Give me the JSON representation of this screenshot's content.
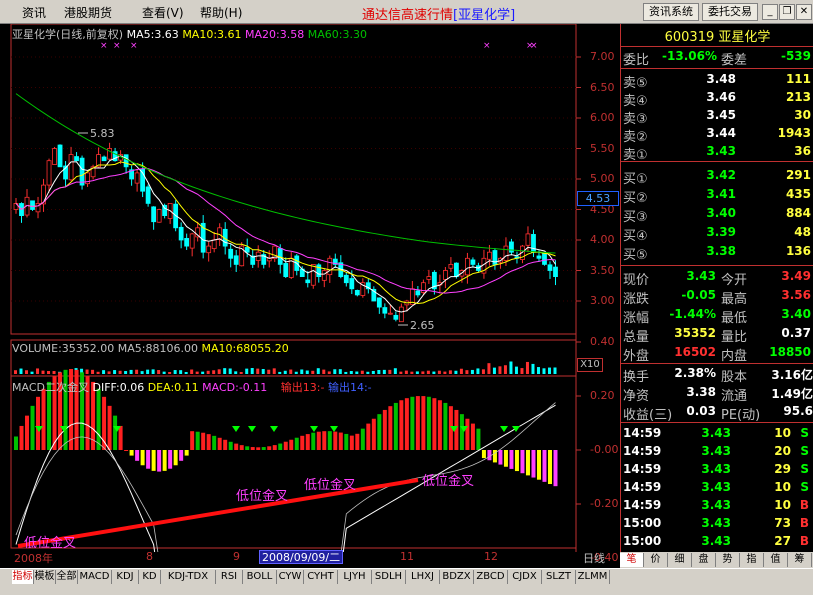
{
  "menu": [
    "资讯",
    "港股期货",
    "查看(V)",
    "帮助(H)"
  ],
  "app": {
    "title": "通达信高速行情",
    "stock_bracket": "[亚星化学]"
  },
  "topbuttons": [
    "资讯系统",
    "委托交易"
  ],
  "window_controls": [
    "minimize-icon",
    "restore-icon",
    "close-icon"
  ],
  "chart": {
    "header": {
      "name": "亚星化学(日线,前复权)",
      "ma5": "MA5:3.63",
      "ma10": "MA10:3.61",
      "ma20": "MA20:3.58",
      "ma60": "MA60:3.30"
    },
    "price_labels": [
      "7.00",
      "6.50",
      "6.00",
      "5.50",
      "5.00",
      "4.50",
      "4.00",
      "3.50",
      "3.00"
    ],
    "current_price": "4.53",
    "high_annotation": "5.83",
    "low_annotation": "2.65",
    "volume_header": {
      "vol": "VOLUME:35352.00",
      "ma5": "MA5:88106.00",
      "ma10": "MA10:68055.20"
    },
    "volume_scale": "X10",
    "macd_header": {
      "name": "MACD二次金叉",
      "diff": "DIFF:0.06",
      "dea": "DEA:0.11",
      "macd": "MACD:-0.11",
      "out13": "输出13:-",
      "out14": "输出14:-"
    },
    "macd_labels": [
      "0.40",
      "0.20",
      "-0.00",
      "-0.20",
      "-0.40"
    ],
    "annotations": [
      "低位金叉",
      "低位金叉",
      "低位金叉",
      "低位金叉"
    ],
    "dates": [
      "2008年",
      "8",
      "9",
      "11",
      "12"
    ],
    "cursor_date": "2008/09/09/二",
    "period": "日线",
    "colors": {
      "up": "#ff3030",
      "down": "#00ffff",
      "ma5": "#ffffff",
      "ma10": "#ffff00",
      "ma20": "#ff40ff",
      "ma60": "#00c000"
    }
  },
  "chart_data": {
    "type": "candlestick",
    "title": "亚星化学(日线,前复权)",
    "ylim": [
      2.5,
      7.25
    ],
    "high": 5.83,
    "low": 2.65,
    "close_series": [
      4.6,
      4.4,
      4.7,
      4.5,
      4.6,
      4.9,
      5.3,
      5.5,
      5.2,
      5.0,
      5.4,
      5.3,
      4.9,
      5.1,
      5.2,
      5.4,
      5.3,
      5.5,
      5.3,
      5.4,
      5.2,
      5.0,
      5.1,
      4.8,
      4.6,
      4.3,
      4.5,
      4.4,
      4.6,
      4.2,
      4.0,
      3.9,
      4.1,
      4.2,
      3.8,
      3.9,
      4.0,
      4.2,
      3.9,
      3.7,
      3.6,
      3.9,
      3.8,
      3.6,
      3.8,
      3.6,
      3.7,
      3.9,
      3.6,
      3.4,
      3.7,
      3.5,
      3.4,
      3.3,
      3.6,
      3.4,
      3.5,
      3.7,
      3.6,
      3.4,
      3.3,
      3.2,
      3.1,
      3.3,
      3.2,
      3.0,
      2.9,
      2.8,
      2.8,
      2.7,
      2.9,
      3.0,
      3.2,
      3.1,
      3.3,
      3.4,
      3.2,
      3.3,
      3.5,
      3.6,
      3.4,
      3.5,
      3.7,
      3.6,
      3.5,
      3.7,
      3.8,
      3.6,
      3.7,
      3.9,
      3.8,
      3.7,
      3.9,
      4.1,
      3.8,
      3.7,
      3.6,
      3.5,
      3.4
    ]
  },
  "panel": {
    "title": "600319 亚星化学",
    "weibi": {
      "label": "委比",
      "value": "-13.06%",
      "label2": "委差",
      "value2": "-539"
    },
    "sell": [
      {
        "label": "卖⑤",
        "price": "3.48",
        "vol": "111"
      },
      {
        "label": "卖④",
        "price": "3.46",
        "vol": "213"
      },
      {
        "label": "卖③",
        "price": "3.45",
        "vol": "30"
      },
      {
        "label": "卖②",
        "price": "3.44",
        "vol": "1943"
      },
      {
        "label": "卖①",
        "price": "3.43",
        "vol": "36"
      }
    ],
    "buy": [
      {
        "label": "买①",
        "price": "3.42",
        "vol": "291"
      },
      {
        "label": "买②",
        "price": "3.41",
        "vol": "435"
      },
      {
        "label": "买③",
        "price": "3.40",
        "vol": "884"
      },
      {
        "label": "买④",
        "price": "3.39",
        "vol": "48"
      },
      {
        "label": "买⑤",
        "price": "3.38",
        "vol": "136"
      }
    ],
    "stats": [
      {
        "l1": "现价",
        "v1": "3.43",
        "c1": "green",
        "l2": "今开",
        "v2": "3.49",
        "c2": "red"
      },
      {
        "l1": "涨跌",
        "v1": "-0.05",
        "c1": "green",
        "l2": "最高",
        "v2": "3.56",
        "c2": "red"
      },
      {
        "l1": "涨幅",
        "v1": "-1.44%",
        "c1": "green",
        "l2": "最低",
        "v2": "3.40",
        "c2": "green"
      },
      {
        "l1": "总量",
        "v1": "35352",
        "c1": "yellow",
        "l2": "量比",
        "v2": "0.37",
        "c2": "white"
      },
      {
        "l1": "外盘",
        "v1": "16502",
        "c1": "red",
        "l2": "内盘",
        "v2": "18850",
        "c2": "green"
      }
    ],
    "stats2": [
      {
        "l1": "换手",
        "v1": "2.38%",
        "l2": "股本",
        "v2": "3.16亿"
      },
      {
        "l1": "净资",
        "v1": "3.38",
        "l2": "流通",
        "v2": "1.49亿"
      },
      {
        "l1": "收益(三)",
        "v1": "0.03",
        "l2": "PE(动)",
        "v2": "95.6"
      }
    ],
    "ticks": [
      {
        "time": "14:59",
        "price": "3.43",
        "vol": "10",
        "side": "S"
      },
      {
        "time": "14:59",
        "price": "3.43",
        "vol": "20",
        "side": "S"
      },
      {
        "time": "14:59",
        "price": "3.43",
        "vol": "29",
        "side": "S"
      },
      {
        "time": "14:59",
        "price": "3.43",
        "vol": "10",
        "side": "S"
      },
      {
        "time": "14:59",
        "price": "3.43",
        "vol": "10",
        "side": "B"
      },
      {
        "time": "15:00",
        "price": "3.43",
        "vol": "73",
        "side": "B"
      },
      {
        "time": "15:00",
        "price": "3.43",
        "vol": "27",
        "side": "B"
      }
    ]
  },
  "tabs": [
    "指标",
    "模板",
    "全部",
    "MACD",
    "KDJ",
    "KD",
    "KDJ-TDX",
    "RSI",
    "BOLL",
    "CYW",
    "CYHT",
    "LJYH",
    "SDLH",
    "LHXJ",
    "BDZX",
    "ZBCD",
    "CJDX",
    "SLZT",
    "ZLMM"
  ],
  "panel_tabs": [
    "笔",
    "价",
    "细",
    "盘",
    "势",
    "指",
    "值",
    "筹"
  ]
}
